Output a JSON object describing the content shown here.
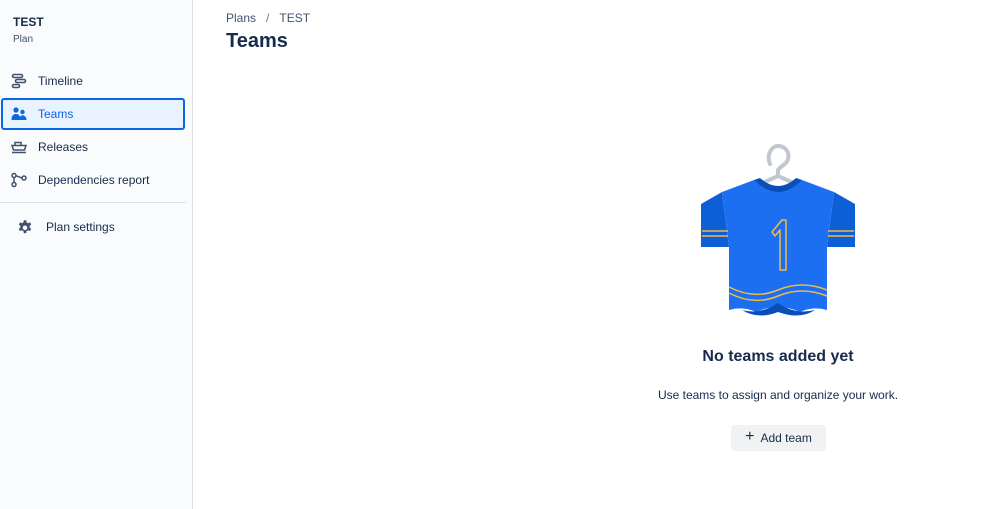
{
  "sidebar": {
    "project_name": "TEST",
    "project_type": "Plan",
    "items": [
      {
        "label": "Timeline",
        "icon": "timeline-icon"
      },
      {
        "label": "Teams",
        "icon": "teams-icon",
        "active": true
      },
      {
        "label": "Releases",
        "icon": "releases-icon"
      },
      {
        "label": "Dependencies report",
        "icon": "dependencies-icon"
      }
    ],
    "settings": {
      "label": "Plan settings",
      "icon": "gear-icon"
    }
  },
  "breadcrumb": {
    "items": [
      "Plans",
      "TEST"
    ],
    "separator": "/"
  },
  "page": {
    "title": "Teams"
  },
  "empty_state": {
    "illustration": "jersey-on-hanger-illustration",
    "jersey_number": "1",
    "heading": "No teams added yet",
    "description": "Use teams to assign and organize your work.",
    "button_label": "Add team",
    "button_icon": "plus-icon"
  },
  "colors": {
    "accent": "#0c66e4",
    "active_bg": "#e9f2ff",
    "text": "#172b4d",
    "sidebar_bg": "#fafbfc",
    "jersey_blue": "#1d6ff2",
    "jersey_trim": "#f5b942"
  }
}
